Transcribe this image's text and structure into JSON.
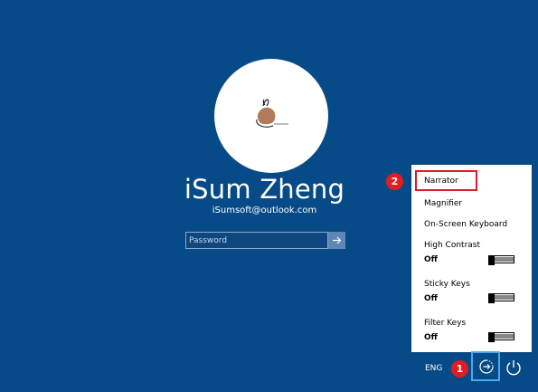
{
  "user": {
    "name": "iSum Zheng",
    "email": "iSumsoft@outlook.com"
  },
  "password": {
    "placeholder": "Password",
    "submit_icon": "arrow-right-icon"
  },
  "ease_menu": {
    "narrator": "Narrator",
    "magnifier": "Magnifier",
    "on_screen_keyboard": "On-Screen Keyboard",
    "high_contrast": {
      "label": "High Contrast",
      "state": "Off"
    },
    "sticky_keys": {
      "label": "Sticky Keys",
      "state": "Off"
    },
    "filter_keys": {
      "label": "Filter Keys",
      "state": "Off"
    }
  },
  "annotations": {
    "step1": "1",
    "step2": "2"
  },
  "tray": {
    "language": "ENG",
    "ease_icon": "ease-of-access-icon",
    "power_icon": "power-icon"
  },
  "colors": {
    "background": "#064a87",
    "badge": "#e31b23",
    "highlight": "#49a9ec"
  }
}
